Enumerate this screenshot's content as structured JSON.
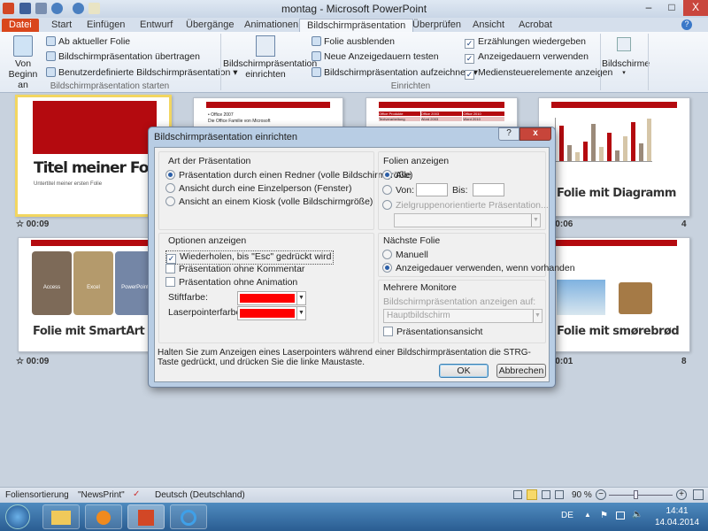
{
  "window": {
    "title": "montag - Microsoft PowerPoint",
    "minimize": "–",
    "maximize": "□",
    "close": "X"
  },
  "tabs": [
    "Datei",
    "Start",
    "Einfügen",
    "Entwurf",
    "Übergänge",
    "Animationen",
    "Bildschirmpräsentation",
    "Überprüfen",
    "Ansicht",
    "Acrobat"
  ],
  "ribbon": {
    "start_group": {
      "big": "Von Beginn an",
      "items": [
        "Ab aktueller Folie",
        "Bildschirmpräsentation übertragen",
        "Benutzerdefinierte Bildschirmpräsentation"
      ],
      "label": "Bildschirmpräsentation starten"
    },
    "setup_group": {
      "big_line1": "Bildschirmpräsentation",
      "big_line2": "einrichten",
      "items": [
        "Folie ausblenden",
        "Neue Anzeigedauern testen",
        "Bildschirmpräsentation aufzeichnen"
      ],
      "checks": [
        {
          "label": "Erzählungen wiedergeben",
          "checked": true
        },
        {
          "label": "Anzeigedauern verwenden",
          "checked": true
        },
        {
          "label": "Mediensteuerelemente anzeigen",
          "checked": true
        }
      ],
      "label": "Einrichten"
    },
    "monitors": {
      "label": "Bildschirme"
    }
  },
  "slides": [
    {
      "title": "Titel meiner Folie",
      "subtitle": "Untertitel meiner ersten Folie",
      "time": "00:09",
      "selected": true
    },
    {
      "bullet1": "Office 2007",
      "bullet2": "Die Office Familie von Microsoft"
    },
    {
      "table": [
        "Office Produkte",
        "Office 2003",
        "Office 2010",
        "Textverarbeitung",
        "Word 2003",
        "Word 2010"
      ]
    },
    {
      "title": "Folie mit Diagramm",
      "time": "00:06",
      "number": "4"
    },
    {
      "title": "Folie mit SmartArt",
      "time": "00:09",
      "items": [
        "Access",
        "Excel",
        "PowerPoint"
      ]
    },
    {
      "title": "Folie mit smørebrød",
      "time": "00:01",
      "number": "8"
    }
  ],
  "dialog": {
    "title": "Bildschirmpräsentation einrichten",
    "help": "?",
    "close": "x",
    "art": {
      "heading": "Art der Präsentation",
      "options": [
        "Präsentation durch einen Redner (volle Bildschirmgröße)",
        "Ansicht durch eine Einzelperson (Fenster)",
        "Ansicht an einem Kiosk (volle Bildschirmgröße)"
      ],
      "selected": 0
    },
    "optionen": {
      "heading": "Optionen anzeigen",
      "checks": [
        {
          "label": "Wiederholen, bis \"Esc\" gedrückt wird",
          "checked": true
        },
        {
          "label": "Präsentation ohne Kommentar",
          "checked": false
        },
        {
          "label": "Präsentation ohne Animation",
          "checked": false
        }
      ],
      "stift_label": "Stiftfarbe:",
      "stift_color": "#ff0000",
      "laser_label": "Laserpointerfarbe:",
      "laser_color": "#ff0000"
    },
    "folien": {
      "heading": "Folien anzeigen",
      "alle": "Alle",
      "von": "Von:",
      "bis": "Bis:",
      "ziel": "Zielgruppenorientierte Präsentation...",
      "von_value": "",
      "bis_value": ""
    },
    "naechste": {
      "heading": "Nächste Folie",
      "options": [
        "Manuell",
        "Anzeigedauer verwenden, wenn vorhanden"
      ],
      "selected": 1
    },
    "monitore": {
      "heading": "Mehrere Monitore",
      "label": "Bildschirmpräsentation anzeigen auf:",
      "value": "Hauptbildschirm",
      "check": "Präsentationsansicht"
    },
    "hint": "Halten Sie zum Anzeigen eines Laserpointers während einer Bildschirmpräsentation die STRG-Taste gedrückt, und drücken Sie die linke Maustaste.",
    "ok": "OK",
    "cancel": "Abbrechen"
  },
  "status": {
    "view": "Foliensortierung",
    "theme": "\"NewsPrint\"",
    "language": "Deutsch (Deutschland)",
    "zoom": "90 %",
    "minus": "−",
    "plus": "+"
  },
  "taskbar": {
    "lang": "DE",
    "time": "14:41",
    "date": "14.04.2014"
  },
  "colors": {
    "accent": "#b40a0f",
    "file_tab": "#d9461c"
  }
}
